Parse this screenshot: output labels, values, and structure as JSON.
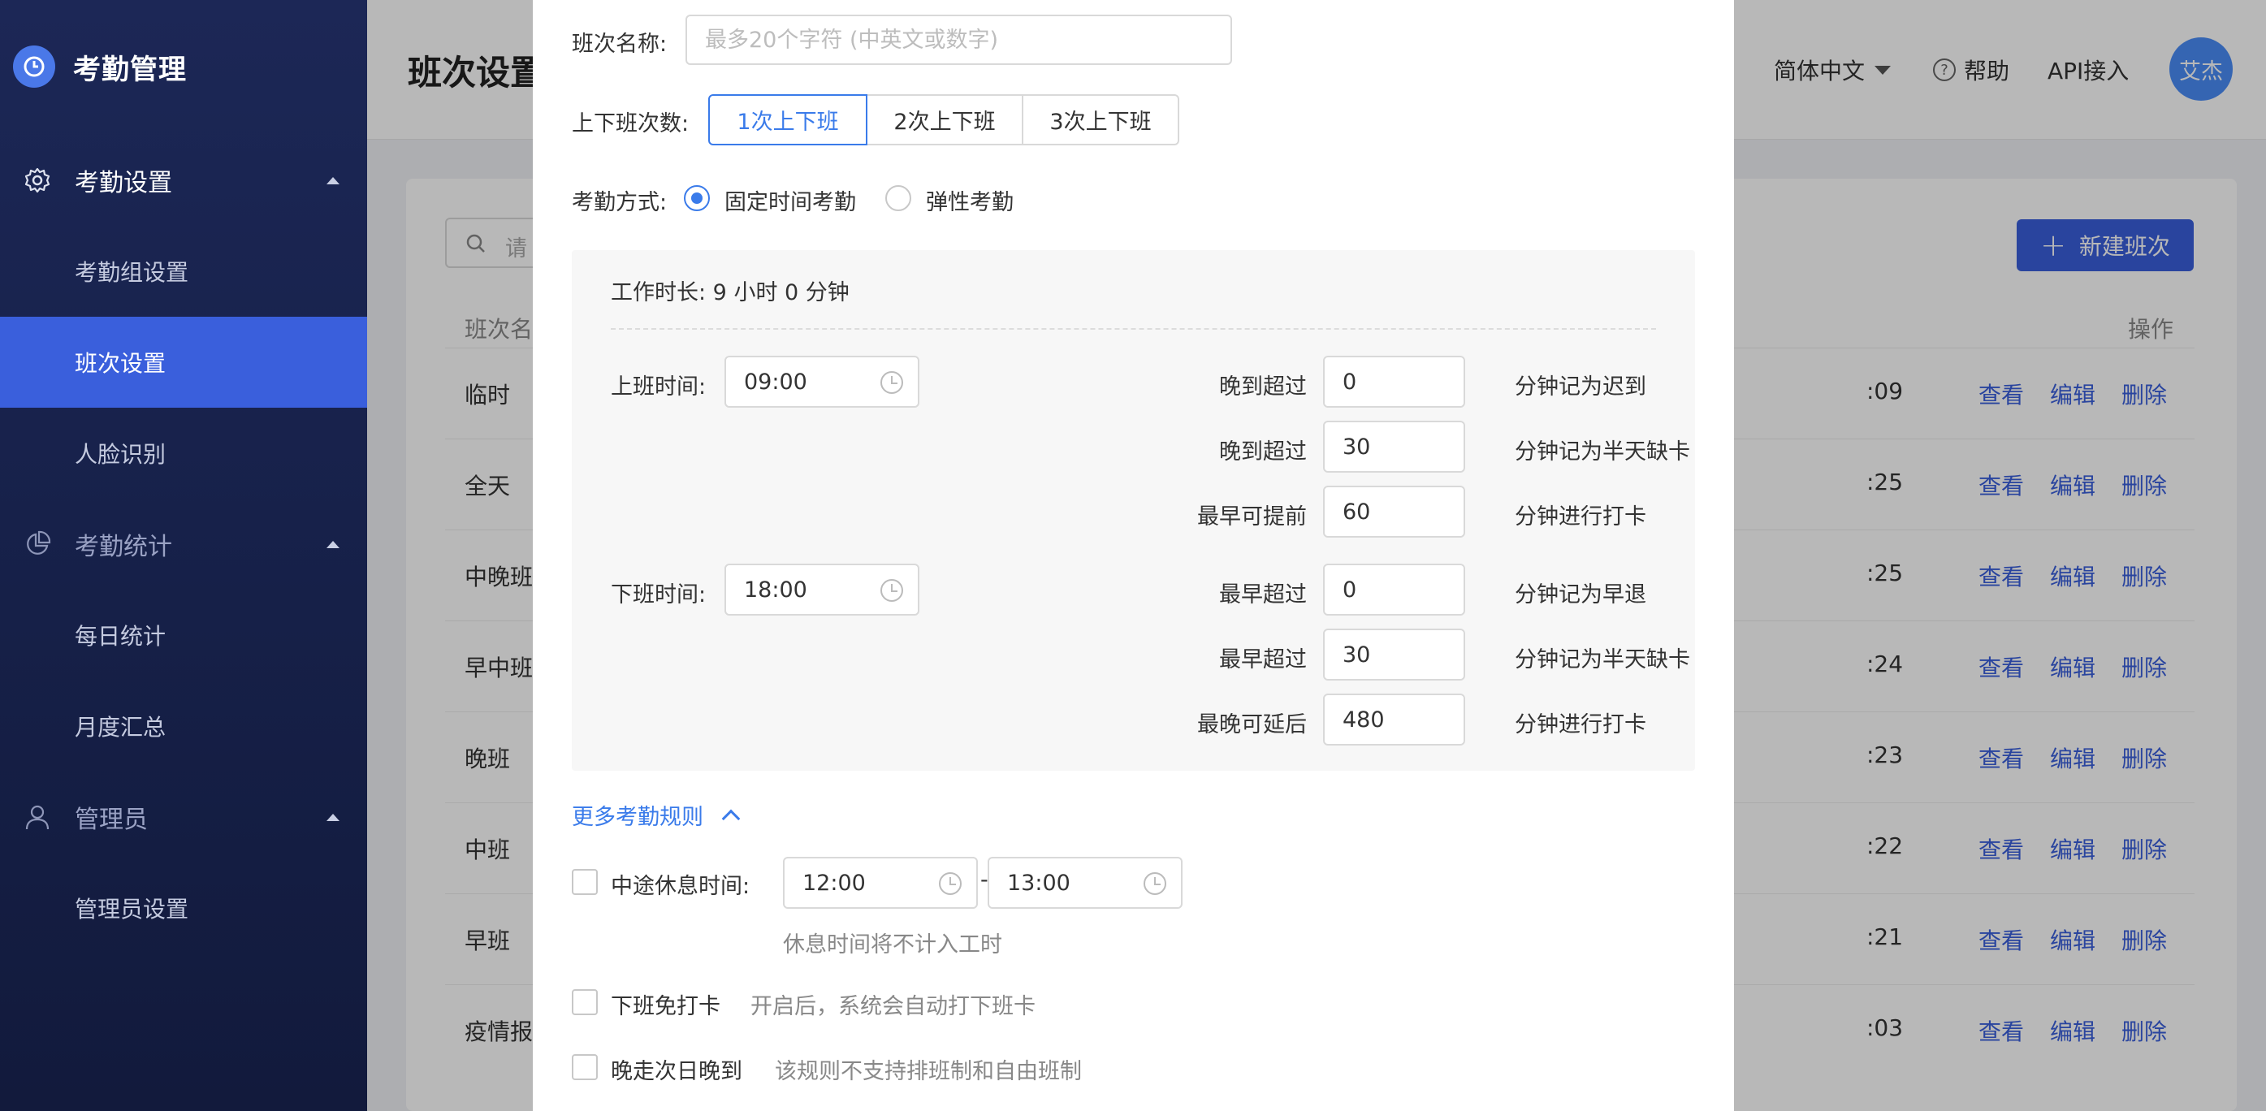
{
  "app": {
    "title": "考勤管理"
  },
  "sidebar": {
    "groups": [
      {
        "label": "考勤设置",
        "items": [
          "考勤组设置",
          "班次设置",
          "人脸识别"
        ]
      },
      {
        "label": "考勤统计",
        "items": [
          "每日统计",
          "月度汇总"
        ]
      },
      {
        "label": "管理员",
        "items": [
          "管理员设置"
        ]
      }
    ],
    "active_item": "班次设置"
  },
  "header": {
    "page_title": "班次设置",
    "language": "简体中文",
    "help": "帮助",
    "api": "API接入",
    "avatar": "艾杰"
  },
  "list": {
    "search_placeholder": "请",
    "new_button": "新建班次",
    "col_name": "班次名",
    "col_op": "操作",
    "rows": [
      {
        "name": "临时",
        "time": ":09"
      },
      {
        "name": "全天",
        "time": ":25"
      },
      {
        "name": "中晚班",
        "time": ":25"
      },
      {
        "name": "早中班",
        "time": ":24"
      },
      {
        "name": "晚班",
        "time": ":23"
      },
      {
        "name": "中班",
        "time": ":22"
      },
      {
        "name": "早班",
        "time": ":21"
      },
      {
        "name": "疫情报",
        "time": ":03"
      }
    ],
    "ops": {
      "view": "查看",
      "edit": "编辑",
      "delete": "删除"
    }
  },
  "form": {
    "name_label": "班次名称:",
    "name_placeholder": "最多20个字符 (中英文或数字)",
    "count_label": "上下班次数:",
    "count_options": [
      "1次上下班",
      "2次上下班",
      "3次上下班"
    ],
    "count_selected": "1次上下班",
    "mode_label": "考勤方式:",
    "mode_options": [
      "固定时间考勤",
      "弹性考勤"
    ],
    "mode_selected": "固定时间考勤",
    "work_duration": "工作时长: 9 小时 0 分钟",
    "on_label": "上班时间:",
    "on_time": "09:00",
    "off_label": "下班时间:",
    "off_time": "18:00",
    "on_rules": [
      {
        "label": "晚到超过",
        "value": "0",
        "hint": "分钟记为迟到"
      },
      {
        "label": "晚到超过",
        "value": "30",
        "hint": "分钟记为半天缺卡"
      },
      {
        "label": "最早可提前",
        "value": "60",
        "hint": "分钟进行打卡"
      }
    ],
    "off_rules": [
      {
        "label": "最早超过",
        "value": "0",
        "hint": "分钟记为早退"
      },
      {
        "label": "最早超过",
        "value": "30",
        "hint": "分钟记为半天缺卡"
      },
      {
        "label": "最晚可延后",
        "value": "480",
        "hint": "分钟进行打卡"
      }
    ],
    "more_rules": "更多考勤规则",
    "break_label": "中途休息时间:",
    "break_start": "12:00",
    "break_sep": "-",
    "break_end": "13:00",
    "break_hint": "休息时间将不计入工时",
    "no_clockout_label": "下班免打卡",
    "no_clockout_hint": "开启后，系统会自动打下班卡",
    "late_next_label": "晚走次日晚到",
    "late_next_hint": "该规则不支持排班制和自由班制"
  }
}
